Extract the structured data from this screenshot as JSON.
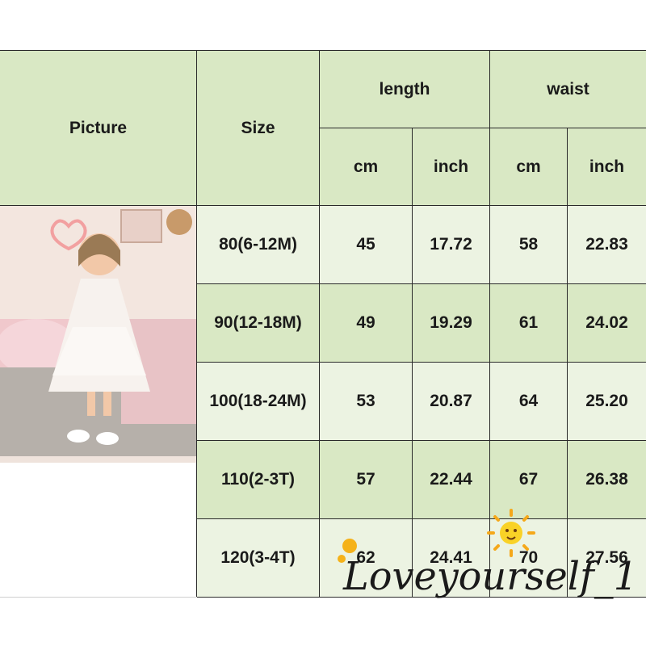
{
  "table": {
    "header": {
      "picture": "Picture",
      "size": "Size",
      "length": "length",
      "waist": "waist",
      "units": [
        "cm",
        "inch",
        "cm",
        "inch"
      ]
    },
    "rows": [
      {
        "size": "80(6-12M)",
        "length_cm": "45",
        "length_inch": "17.72",
        "waist_cm": "58",
        "waist_inch": "22.83"
      },
      {
        "size": "90(12-18M)",
        "length_cm": "49",
        "length_inch": "19.29",
        "waist_cm": "61",
        "waist_inch": "24.02"
      },
      {
        "size": "100(18-24M)",
        "length_cm": "53",
        "length_inch": "20.87",
        "waist_cm": "64",
        "waist_inch": "25.20"
      },
      {
        "size": "110(2-3T)",
        "length_cm": "57",
        "length_inch": "22.44",
        "waist_cm": "67",
        "waist_inch": "26.38"
      },
      {
        "size": "120(3-4T)",
        "length_cm": "62",
        "length_inch": "24.41",
        "waist_cm": "70",
        "waist_inch": "27.56"
      }
    ]
  },
  "watermark": {
    "text": "Loveyourself_1"
  },
  "colors": {
    "header_green": "#d9e8c4",
    "row_light": "#ecf3e2",
    "border": "#2a2a2a"
  }
}
